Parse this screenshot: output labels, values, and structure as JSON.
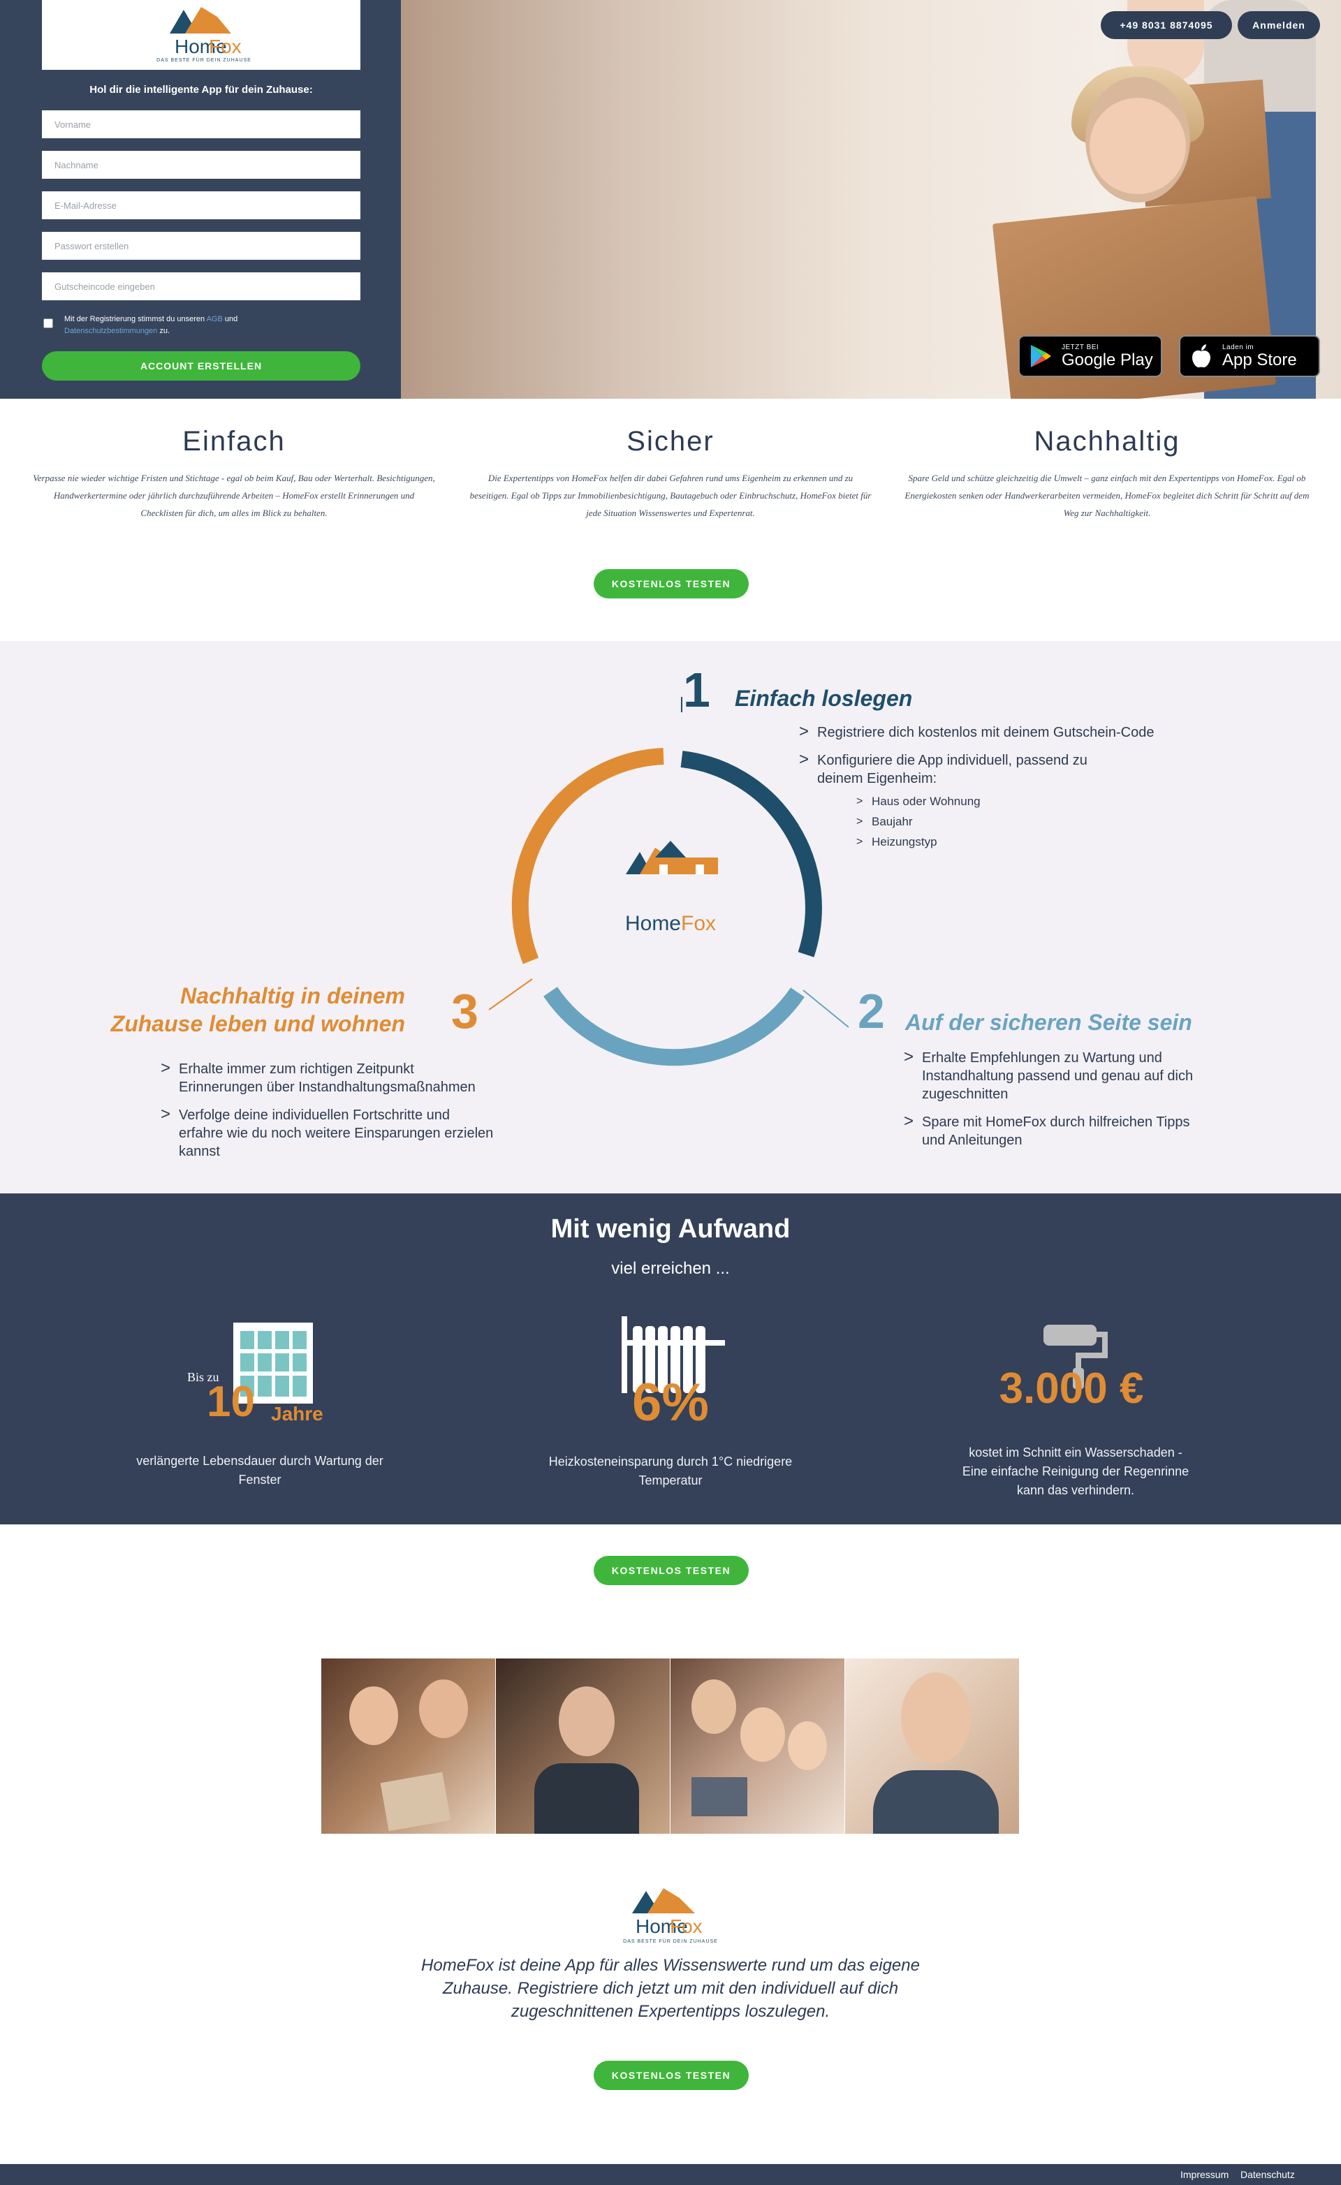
{
  "hero": {
    "form_heading": "Hol dir die intelligente App für dein Zuhause:",
    "fields": {
      "first_name": "Vorname",
      "last_name": "Nachname",
      "email": "E-Mail-Adresse",
      "password": "Passwort erstellen",
      "voucher": "Gutscheincode eingeben"
    },
    "consent": {
      "prefix": "Mit der Registrierung stimmst du unseren",
      "agb": "AGB",
      "and": "und",
      "privacy": "Datenschutzbestimmungen",
      "suffix": "zu."
    },
    "submit_label": "ACCOUNT ERSTELLEN",
    "phone": "+49 8031 8874095",
    "login": "Anmelden",
    "google_play": {
      "small": "JETZT BEI",
      "big": "Google Play"
    },
    "app_store": {
      "small": "Laden im",
      "big": "App Store"
    }
  },
  "brand": {
    "name_part1": "Home",
    "name_part2": "Fox",
    "tagline": "DAS BESTE FÜR DEIN ZUHAUSE",
    "color_navy": "#1f4e6b",
    "color_orange": "#e08c34"
  },
  "features": [
    {
      "title": "Einfach",
      "text": "Verpasse nie wieder wichtige Fristen und Stichtage - egal ob beim Kauf, Bau oder Werterhalt. Besichtigungen, Handwerkertermine oder jährlich durchzuführende Arbeiten – HomeFox erstellt Erinnerungen und Checklisten für dich, um alles im Blick zu behalten."
    },
    {
      "title": "Sicher",
      "text": "Die Expertentipps von HomeFox helfen dir dabei Gefahren rund ums Eigenheim zu erkennen und zu beseitigen. Egal ob Tipps zur Immobilienbesichtigung, Bautagebuch oder Einbruchschutz, HomeFox bietet für jede Situation Wissenswertes und Expertenrat."
    },
    {
      "title": "Nachhaltig",
      "text": "Spare Geld und schütze gleichzeitig die Umwelt – ganz einfach mit den Expertentipps von HomeFox. Egal ob Energiekosten senken oder Handwerkerarbeiten vermeiden, HomeFox begleitet dich Schritt für Schritt auf dem Weg zur Nachhaltigkeit."
    }
  ],
  "cta_label": "KOSTENLOS TESTEN",
  "steps": {
    "one": {
      "num": "1",
      "title": "Einfach loslegen",
      "items": [
        "Registriere dich kostenlos mit deinem Gutschein-Code",
        "Konfiguriere die App individuell, passend zu deinem Eigenheim:"
      ],
      "sub_items": [
        "Haus oder Wohnung",
        "Baujahr",
        "Heizungstyp"
      ],
      "color": "#1f4e6b"
    },
    "two": {
      "num": "2",
      "title": "Auf der sicheren Seite sein",
      "items": [
        "Erhalte Empfehlungen zu Wartung und Instandhaltung passend und genau auf dich zugeschnitten",
        "Spare mit HomeFox durch hilfreichen Tipps und Anleitungen"
      ],
      "color": "#6aa3c0"
    },
    "three": {
      "num": "3",
      "title_line1": "Nachhaltig in deinem",
      "title_line2": "Zuhause leben und wohnen",
      "items": [
        "Erhalte immer zum richtigen Zeitpunkt Erinnerungen über Instandhaltungsmaßnahmen",
        "Verfolge deine individuellen Fortschritte und erfahre wie du noch weitere Einsparungen erzielen kannst"
      ],
      "color": "#e08c34"
    }
  },
  "stats": {
    "title": "Mit wenig Aufwand",
    "subtitle": "viel erreichen ...",
    "items": [
      {
        "prefix": "Bis zu",
        "value": "10",
        "unit": "Jahre",
        "desc": "verlängerte Lebensdauer durch Wartung der Fenster",
        "icon": "window-icon"
      },
      {
        "value": "6%",
        "desc": "Heizkosteneinsparung durch 1°C niedrigere Temperatur",
        "icon": "radiator-icon"
      },
      {
        "value": "3.000 €",
        "desc": "kostet im Schnitt ein Wasserschaden - Eine einfache Reinigung der Regenrinne kann das verhindern.",
        "icon": "paint-roller-icon"
      }
    ]
  },
  "bottom": {
    "text": "HomeFox ist deine App für alles Wissenswerte rund um das eigene Zuhause. Registriere dich jetzt um mit den individuell auf dich zugeschnittenen Expertentipps loszulegen."
  },
  "footer": {
    "impressum": "Impressum",
    "datenschutz": "Datenschutz"
  }
}
